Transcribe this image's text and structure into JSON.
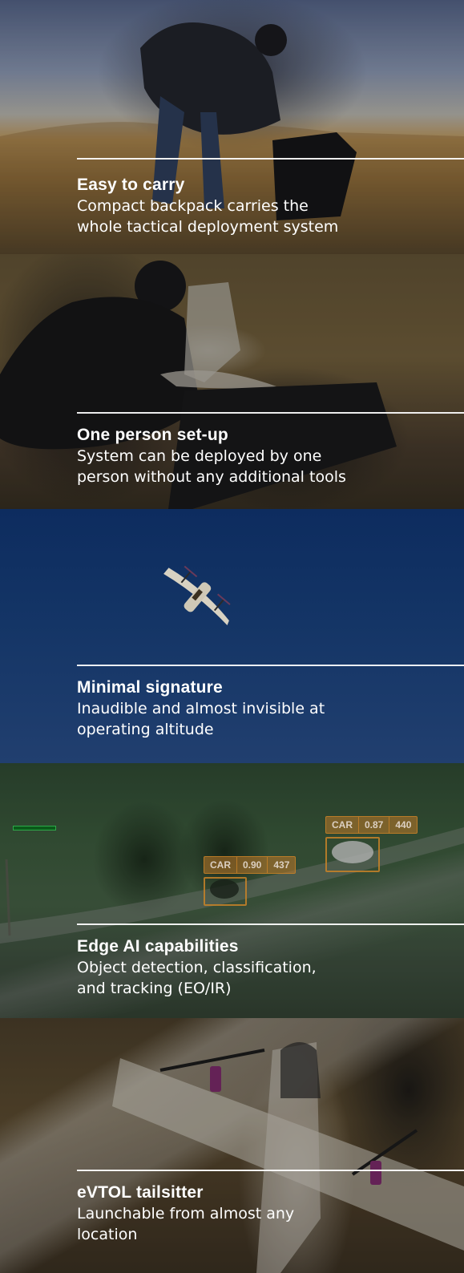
{
  "features": [
    {
      "title": "Easy to carry",
      "description": "Compact backpack carries  the\nwhole tactical deployment system"
    },
    {
      "title": "One person set-up",
      "description": "System can be deployed by one\nperson without any additional tools"
    },
    {
      "title": "Minimal signature",
      "description": "Inaudible and almost invisible at\noperating altitude"
    },
    {
      "title": "Edge AI capabilities",
      "description": "Object detection, classification,\nand tracking (EO/IR)"
    },
    {
      "title": "eVTOL tailsitter",
      "description": "Launchable from almost any\nlocation"
    }
  ],
  "detections": [
    {
      "label": "CAR",
      "confidence": "0.87",
      "id": "440"
    },
    {
      "label": "CAR",
      "confidence": "0.90",
      "id": "437"
    }
  ],
  "colors": {
    "sky_panel": "#143566",
    "detection_box": "#c8822a",
    "tracker_indicator": "#2fa84a",
    "text": "#ffffff"
  }
}
